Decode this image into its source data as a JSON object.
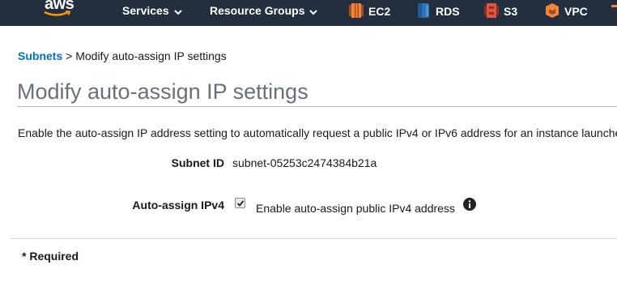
{
  "header": {
    "logo_text": "aws",
    "menus": [
      {
        "label": "Services"
      },
      {
        "label": "Resource Groups"
      }
    ],
    "services": [
      {
        "label": "EC2",
        "icon": "ec2-icon",
        "color": "#f58536"
      },
      {
        "label": "RDS",
        "icon": "rds-icon",
        "color": "#2e73b8"
      },
      {
        "label": "S3",
        "icon": "s3-icon",
        "color": "#e05243"
      },
      {
        "label": "VPC",
        "icon": "vpc-icon",
        "color": "#f58536"
      }
    ]
  },
  "breadcrumb": {
    "link": "Subnets",
    "separator": ">",
    "current": "Modify auto-assign IP settings"
  },
  "page": {
    "title": "Modify auto-assign IP settings",
    "description": "Enable the auto-assign IP address setting to automatically request a public IPv4 or IPv6 address for an instance launche"
  },
  "form": {
    "subnet_id_label": "Subnet ID",
    "subnet_id_value": "subnet-05253c2474384b21a",
    "auto_assign_label": "Auto-assign IPv4",
    "auto_assign_checked": true,
    "auto_assign_option": "Enable auto-assign public IPv4 address"
  },
  "footer": {
    "required_note": "* Required"
  },
  "colors": {
    "nav_bg": "#232f3e",
    "link": "#0073bb",
    "title": "#6a7079"
  }
}
